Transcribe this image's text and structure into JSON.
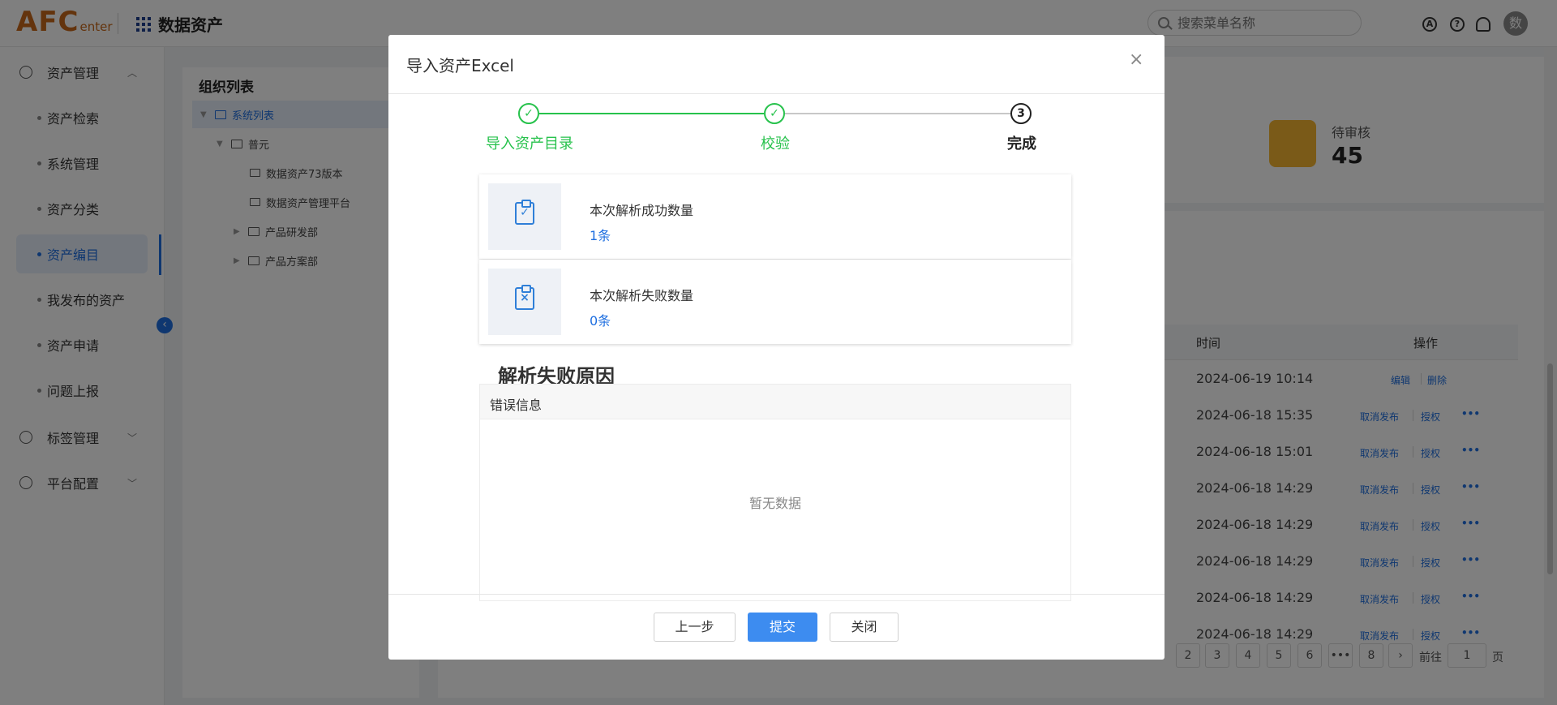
{
  "header": {
    "logo_main": "AFC",
    "logo_sub": "enter",
    "app_title": "数据资产",
    "search_placeholder": "搜索菜单名称",
    "avatar_text": "数"
  },
  "sidebar": {
    "groups": [
      {
        "label": "资产管理"
      },
      {
        "label": "标签管理"
      },
      {
        "label": "平台配置"
      }
    ],
    "items": [
      {
        "label": "资产检索"
      },
      {
        "label": "系统管理"
      },
      {
        "label": "资产分类"
      },
      {
        "label": "资产编目"
      },
      {
        "label": "我发布的资产"
      },
      {
        "label": "资产申请"
      },
      {
        "label": "问题上报"
      }
    ],
    "active_item": "资产编目"
  },
  "tree": {
    "title": "组织列表",
    "nodes": [
      {
        "label": "系统列表"
      },
      {
        "label": "普元"
      },
      {
        "label": "数据资产73版本"
      },
      {
        "label": "数据资产管理平台"
      },
      {
        "label": "产品研发部"
      },
      {
        "label": "产品方案部"
      }
    ]
  },
  "stats": {
    "pending_label": "待审核",
    "pending_value": "45",
    "pending_color": "#f5b531"
  },
  "table": {
    "col_time": "时间",
    "col_ops": "操作",
    "rows": [
      {
        "time": "2024-06-19 10:14",
        "op1": "编辑",
        "op2": "删除"
      },
      {
        "time": "2024-06-18 15:35",
        "op1": "取消发布",
        "op2": "授权"
      },
      {
        "time": "2024-06-18 15:01",
        "op1": "取消发布",
        "op2": "授权"
      },
      {
        "time": "2024-06-18 14:29",
        "op1": "取消发布",
        "op2": "授权"
      },
      {
        "time": "2024-06-18 14:29",
        "op1": "取消发布",
        "op2": "授权"
      },
      {
        "time": "2024-06-18 14:29",
        "op1": "取消发布",
        "op2": "授权"
      },
      {
        "time": "2024-06-18 14:29",
        "op1": "取消发布",
        "op2": "授权"
      },
      {
        "time": "2024-06-18 14:29",
        "op1": "取消发布",
        "op2": "授权"
      }
    ],
    "more_glyph": "•••"
  },
  "pagination": {
    "pages": [
      "2",
      "3",
      "4",
      "5",
      "6",
      "•••",
      "8"
    ],
    "next": "›",
    "goto_label": "前往",
    "goto_value": "1",
    "page_unit": "页"
  },
  "modal": {
    "title": "导入资产Excel",
    "close_glyph": "×",
    "steps": [
      {
        "label": "导入资产目录",
        "state": "done"
      },
      {
        "label": "校验",
        "state": "done"
      },
      {
        "label": "完成",
        "state": "current",
        "number": "3"
      }
    ],
    "check_glyph": "✓",
    "success_card": {
      "title": "本次解析成功数量",
      "value": "1条",
      "mark": "✓"
    },
    "fail_card": {
      "title": "本次解析失败数量",
      "value": "0条",
      "mark": "×"
    },
    "fail_section_title": "解析失败原因",
    "error_column": "错误信息",
    "empty_text": "暂无数据",
    "buttons": {
      "prev": "上一步",
      "submit": "提交",
      "close": "关闭"
    },
    "accent_green": "#27c24c",
    "accent_blue": "#3d8cf0"
  }
}
